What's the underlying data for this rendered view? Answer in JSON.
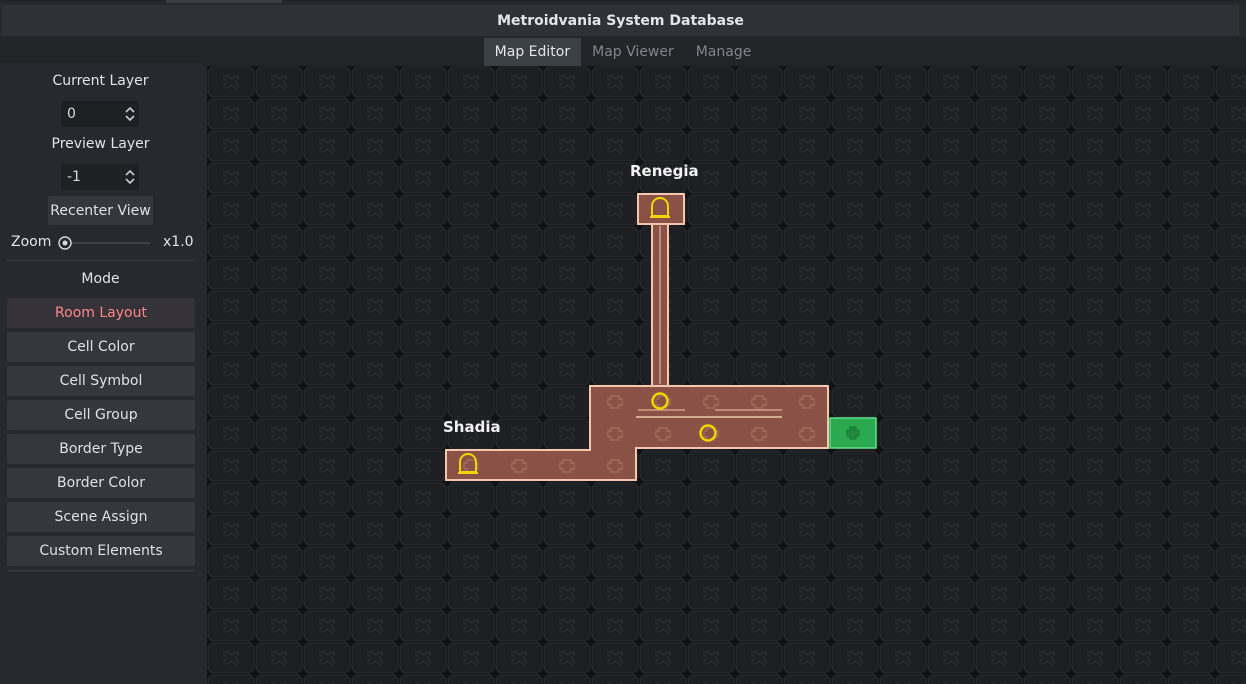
{
  "app": {
    "title": "Metroidvania System Database"
  },
  "tabs": [
    {
      "label": "Map Editor",
      "active": true
    },
    {
      "label": "Map Viewer",
      "active": false
    },
    {
      "label": "Manage",
      "active": false
    }
  ],
  "sidebar": {
    "current_layer_label": "Current Layer",
    "current_layer_value": "0",
    "preview_layer_label": "Preview Layer",
    "preview_layer_value": "-1",
    "recenter_label": "Recenter View",
    "zoom_label": "Zoom",
    "zoom_value": "x1.0",
    "mode_label": "Mode",
    "modes": [
      {
        "label": "Room Layout",
        "active": true
      },
      {
        "label": "Cell Color",
        "active": false
      },
      {
        "label": "Cell Symbol",
        "active": false
      },
      {
        "label": "Cell Group",
        "active": false
      },
      {
        "label": "Border Type",
        "active": false
      },
      {
        "label": "Border Color",
        "active": false
      },
      {
        "label": "Scene Assign",
        "active": false
      },
      {
        "label": "Custom Elements",
        "active": false
      }
    ]
  },
  "map": {
    "rooms": [
      {
        "name": "Renegia"
      },
      {
        "name": "Shadia"
      }
    ],
    "colors": {
      "room_fill": "#8a5146",
      "room_border": "#f2c7ae",
      "symbol": "#f2d500",
      "highlight_cell": "#2aa94f",
      "grid_line": "#101012",
      "grid_cell": "#1d1e21"
    }
  }
}
